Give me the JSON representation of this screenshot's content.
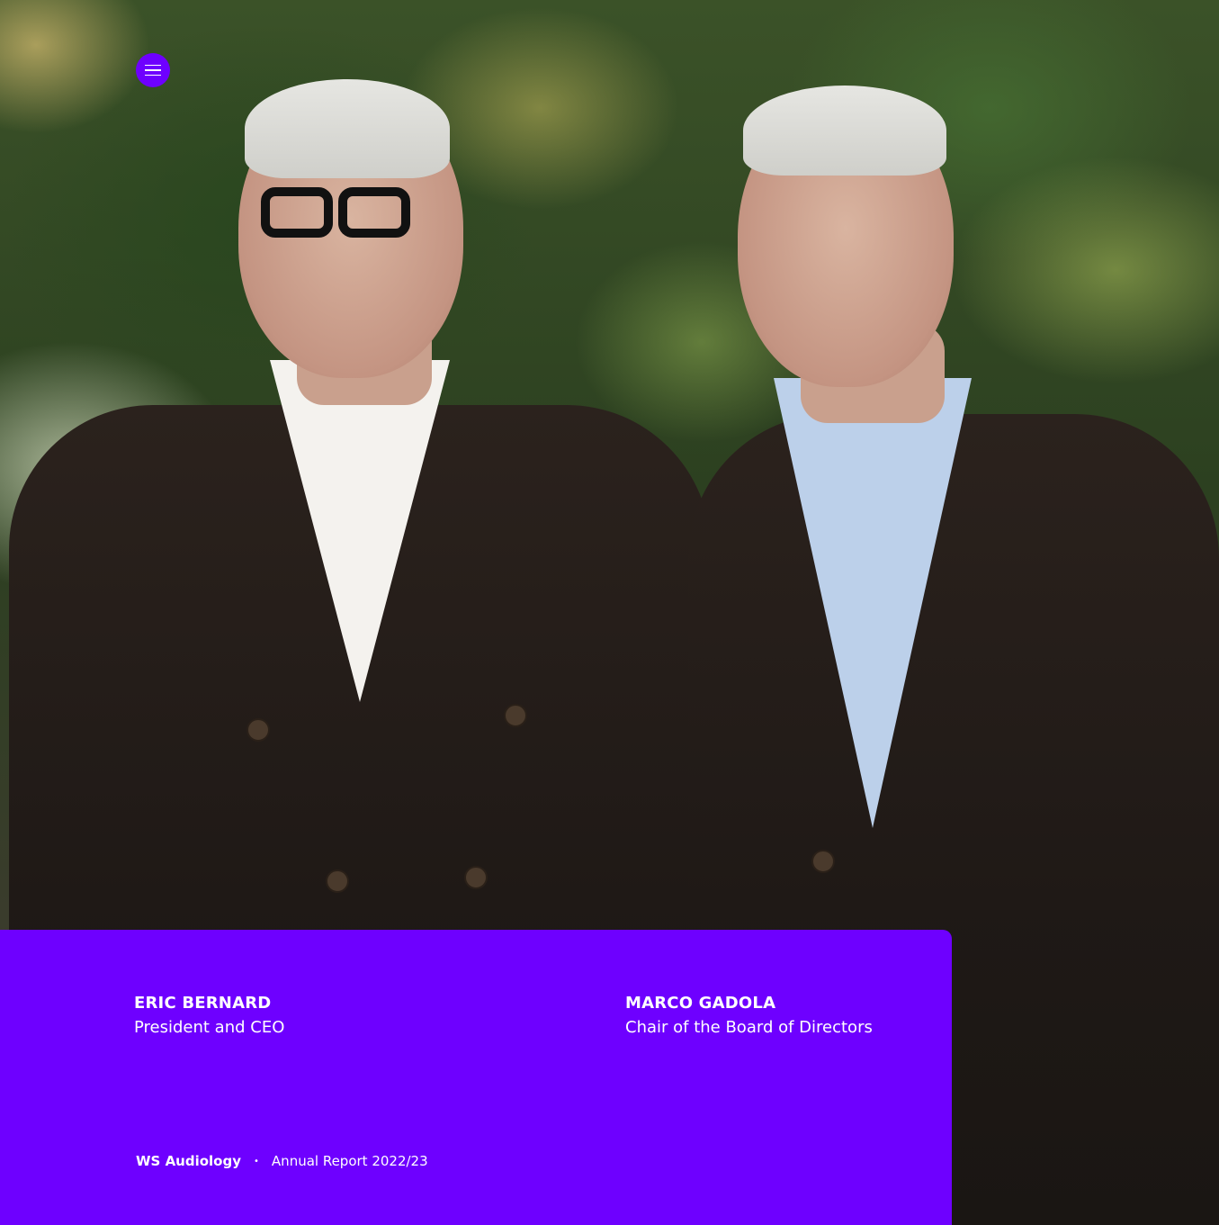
{
  "menu": {
    "icon": "hamburger-menu-icon",
    "accent_color": "#6e00ff"
  },
  "photo": {
    "people": [
      {
        "name": "ERIC BERNARD",
        "shirt_color": "#f4f2ee"
      },
      {
        "name": "MARCO GADOLA",
        "shirt_color": "#bcd0ea"
      }
    ]
  },
  "panel": {
    "background_color": "#6e00ff",
    "people": [
      {
        "name": "ERIC BERNARD",
        "role": "President and CEO"
      },
      {
        "name": "MARCO GADOLA",
        "role": "Chair of the Board of Directors"
      }
    ],
    "footer": {
      "brand": "WS Audiology",
      "separator": "•",
      "report": "Annual Report 2022/23"
    }
  }
}
